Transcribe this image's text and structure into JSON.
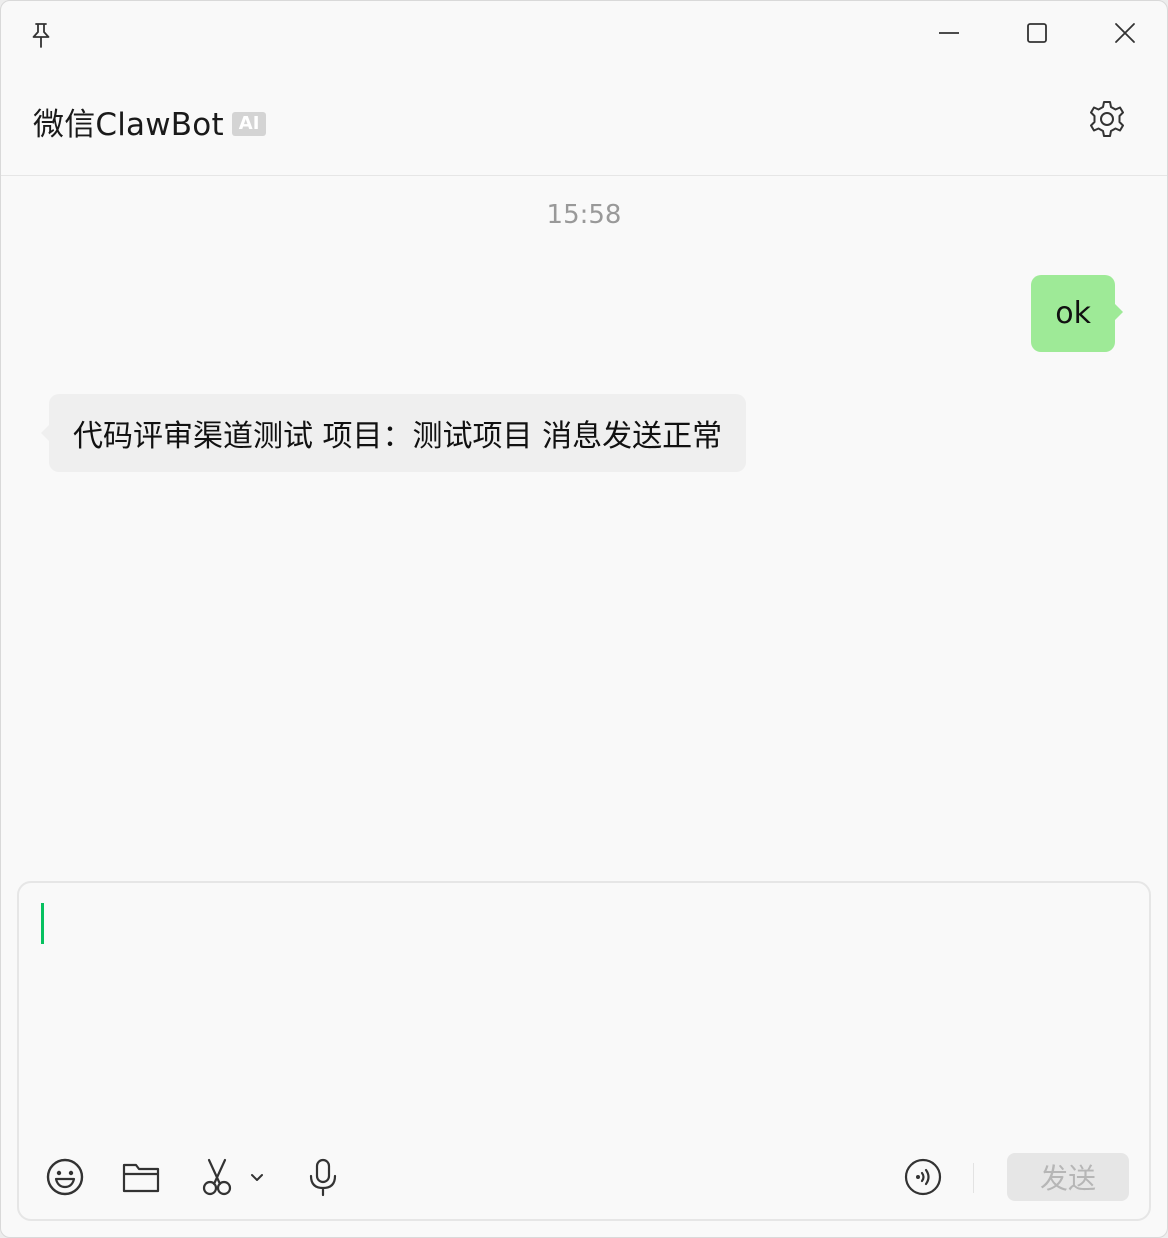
{
  "window": {
    "icons": {
      "pin": "pin-icon",
      "minimize": "minimize-icon",
      "maximize": "maximize-icon",
      "close": "close-icon"
    }
  },
  "header": {
    "title": "微信ClawBot",
    "badge": "AI",
    "settings_icon": "gear-icon"
  },
  "messages": {
    "timestamp": "15:58",
    "items": [
      {
        "direction": "outgoing",
        "text": "ok"
      },
      {
        "direction": "incoming",
        "text": "代码评审渠道测试 项目：测试项目 消息发送正常"
      }
    ]
  },
  "composer": {
    "input_value": "",
    "toolbar": {
      "emoji": "emoji-icon",
      "file": "folder-icon",
      "screenshot": "scissors-icon",
      "screenshot_options": "chevron-down-icon",
      "voice": "microphone-icon",
      "voice_call": "voice-call-icon"
    },
    "send_label": "发送"
  },
  "colors": {
    "outgoing_bubble": "#9eea97",
    "incoming_bubble": "#efefef",
    "caret": "#07c160",
    "send_disabled_bg": "#e6e6e6",
    "send_disabled_text": "#b6b6b6"
  }
}
